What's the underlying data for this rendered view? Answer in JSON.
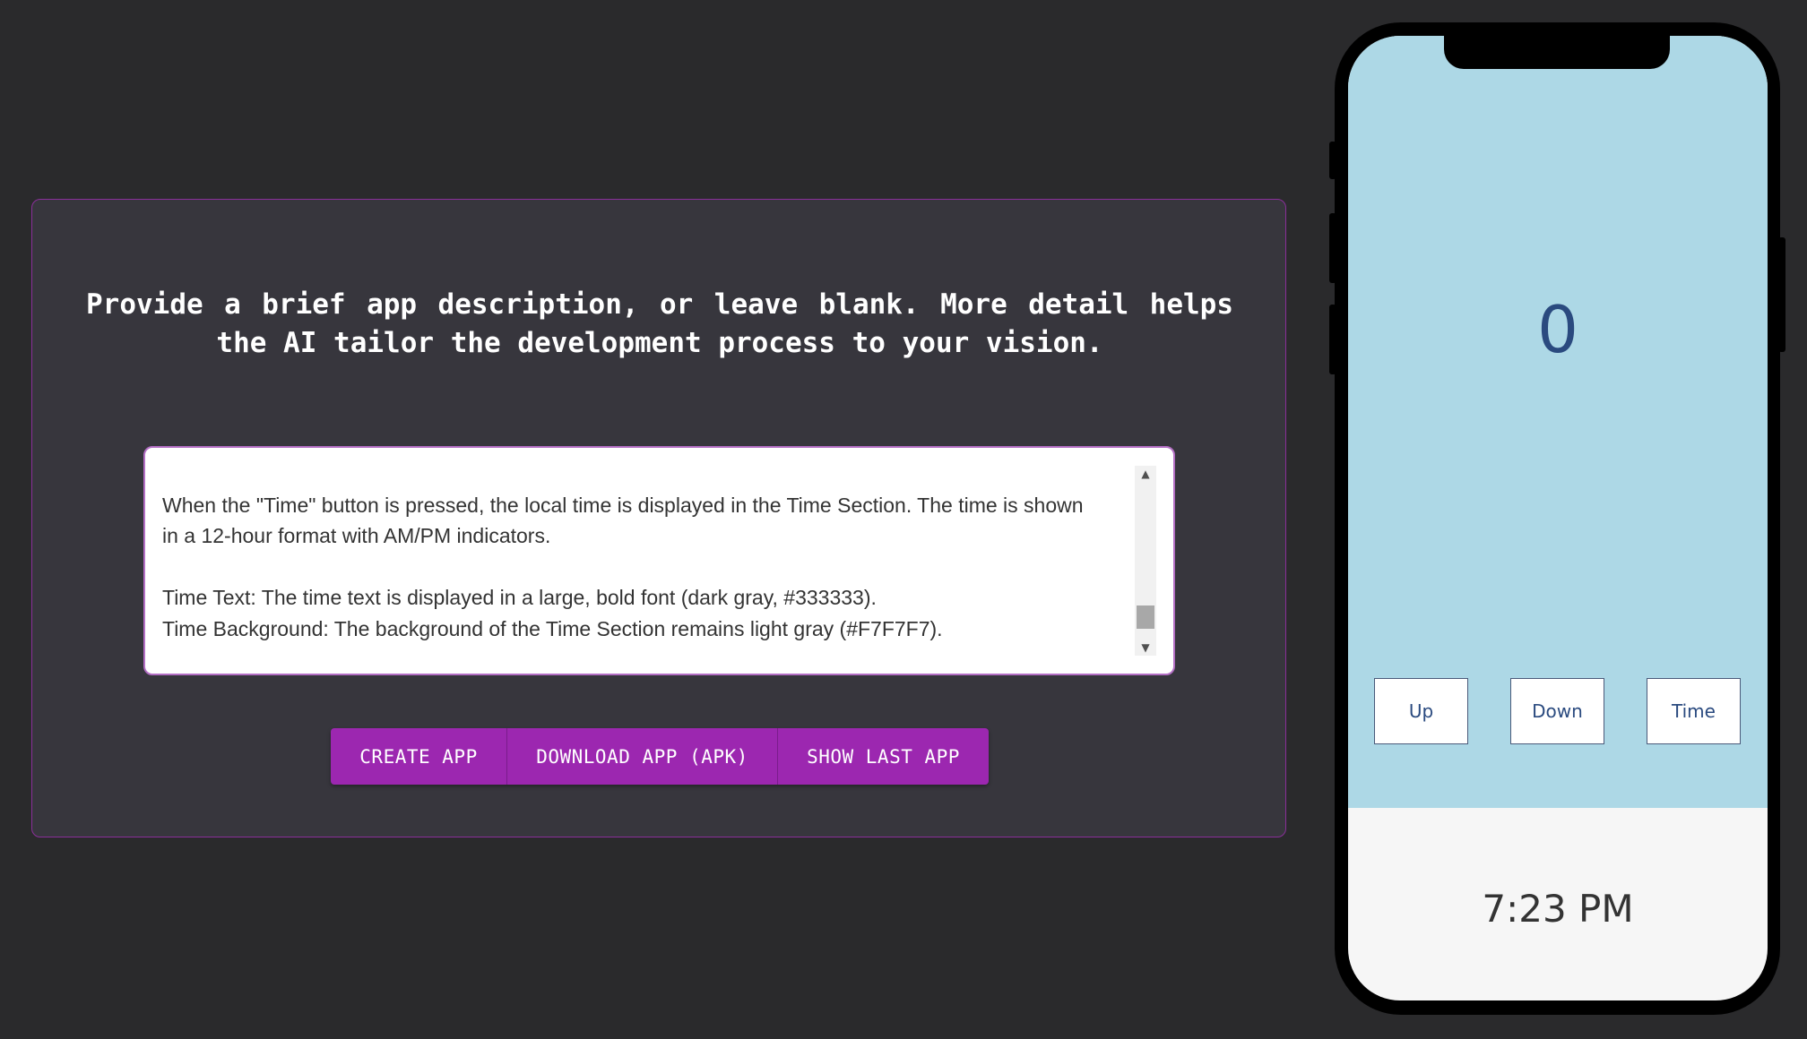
{
  "prompt": {
    "text": "Provide a brief app description, or leave blank. More detail helps the AI tailor the development process to your vision."
  },
  "description": {
    "value": "\nWhen the \"Time\" button is pressed, the local time is displayed in the Time Section. The time is shown in a 12-hour format with AM/PM indicators.\n\nTime Text: The time text is displayed in a large, bold font (dark gray, #333333).\nTime Background: The background of the Time Section remains light gray (#F7F7F7)."
  },
  "buttons": {
    "create": "CREATE APP",
    "download": "DOWNLOAD APP (APK)",
    "show_last": "SHOW LAST APP"
  },
  "phone_app": {
    "counter": "0",
    "up_label": "Up",
    "down_label": "Down",
    "time_label": "Time",
    "time_display": "7:23 PM"
  },
  "colors": {
    "background": "#2a2a2c",
    "panel": "#37363d",
    "accent": "#9c27b0",
    "phone_top": "#add8e6",
    "phone_bottom": "#f6f6f6"
  }
}
